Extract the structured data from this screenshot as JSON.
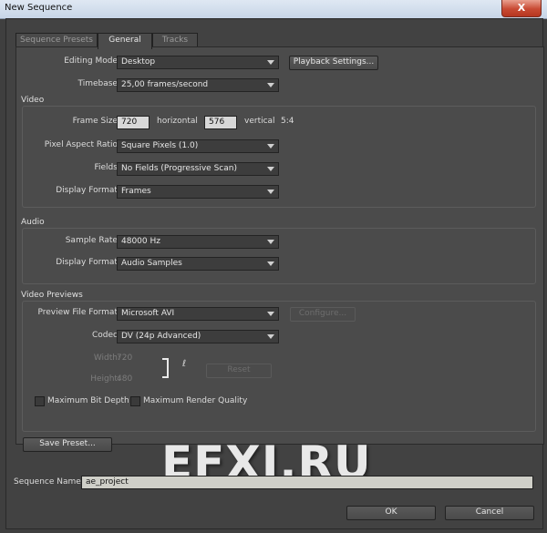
{
  "window": {
    "title": "New Sequence",
    "close_glyph": "X"
  },
  "tabs": [
    {
      "label": "Sequence Presets",
      "active": false
    },
    {
      "label": "General",
      "active": true
    },
    {
      "label": "Tracks",
      "active": false
    }
  ],
  "general": {
    "editing_mode": {
      "label": "Editing Mode:",
      "value": "Desktop"
    },
    "playback_settings_button": "Playback Settings...",
    "timebase": {
      "label": "Timebase:",
      "value": "25,00 frames/second"
    }
  },
  "video": {
    "legend": "Video",
    "frame_size": {
      "label": "Frame Size:",
      "width": "720",
      "horizontal_label": "horizontal",
      "height": "576",
      "vertical_label": "vertical",
      "ratio": "5:4"
    },
    "pixel_aspect": {
      "label": "Pixel Aspect Ratio:",
      "value": "Square Pixels (1.0)"
    },
    "fields": {
      "label": "Fields:",
      "value": "No Fields (Progressive Scan)"
    },
    "display_format": {
      "label": "Display Format:",
      "value": "Frames"
    }
  },
  "audio": {
    "legend": "Audio",
    "sample_rate": {
      "label": "Sample Rate:",
      "value": "48000 Hz"
    },
    "display_format": {
      "label": "Display Format:",
      "value": "Audio Samples"
    }
  },
  "video_previews": {
    "legend": "Video Previews",
    "preview_file_format": {
      "label": "Preview File Format:",
      "value": "Microsoft AVI"
    },
    "configure_button": "Configure...",
    "codec": {
      "label": "Codec:",
      "value": "DV (24p Advanced)"
    },
    "width": {
      "label": "Width:",
      "value": "720"
    },
    "height": {
      "label": "Height:",
      "value": "480"
    },
    "reset_button": "Reset",
    "max_bit_depth": {
      "label": "Maximum Bit Depth",
      "checked": false
    },
    "max_render_quality": {
      "label": "Maximum Render Quality",
      "checked": false
    }
  },
  "save_preset_button": "Save Preset...",
  "sequence_name": {
    "label": "Sequence Name:",
    "value": "ae_project"
  },
  "ok_button": "OK",
  "cancel_button": "Cancel",
  "watermark": "EFXI.RU",
  "icons": {
    "link": "chain-link-icon",
    "close": "close-icon",
    "dropdown": "chevron-down-icon"
  },
  "colors": {
    "background": "#3f3f3f",
    "panel": "#4b4b4b",
    "close_button": "#c84a33",
    "field": "#d8d8d8"
  }
}
